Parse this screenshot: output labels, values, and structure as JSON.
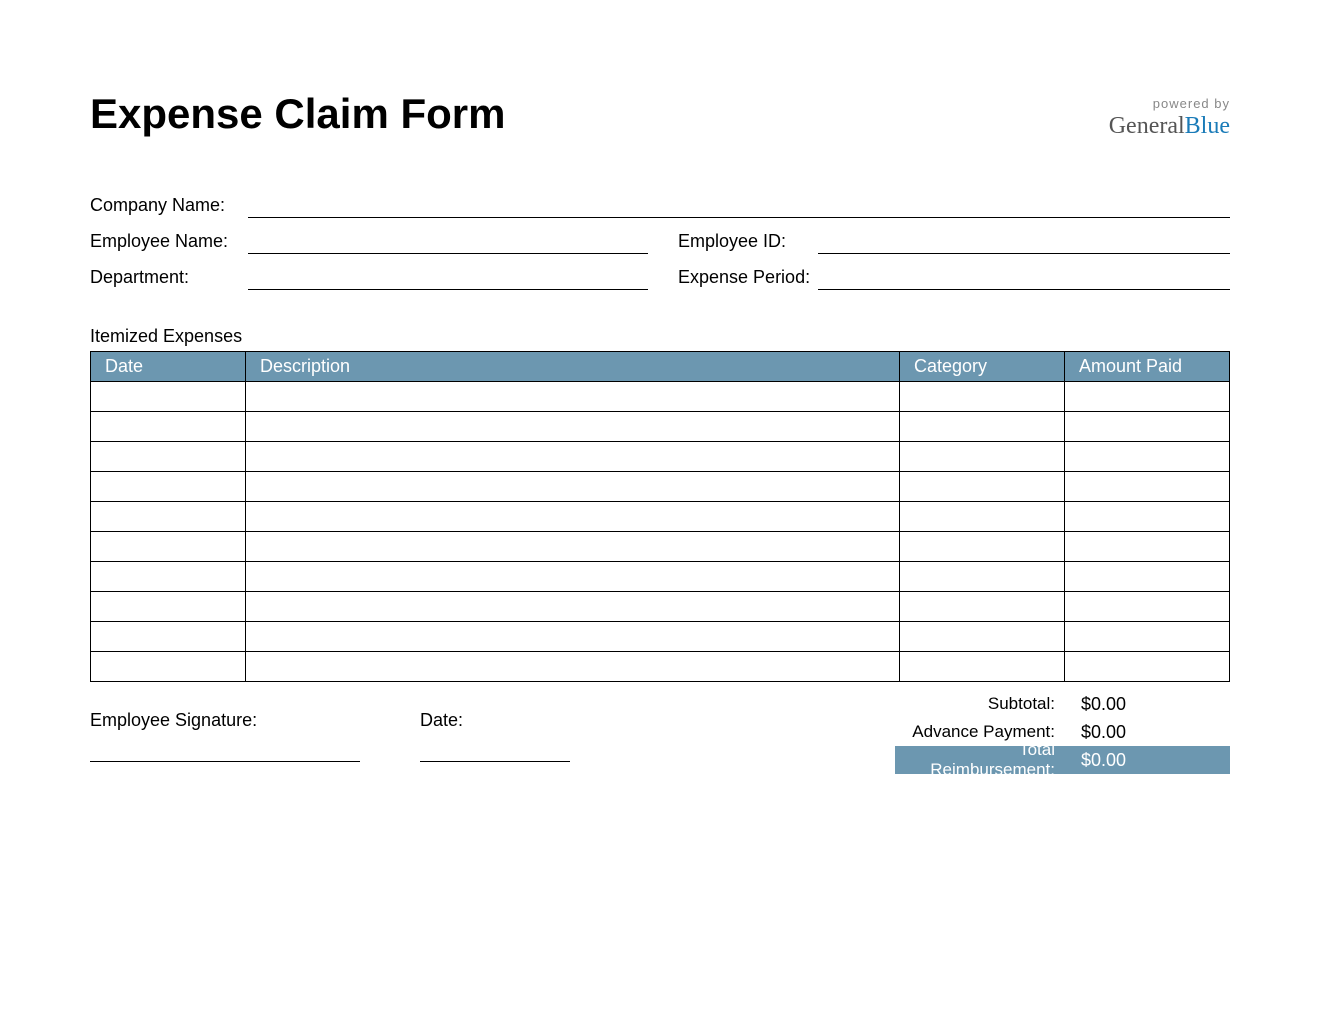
{
  "title": "Expense Claim Form",
  "logo": {
    "powered": "powered by",
    "brand1": "General",
    "brand2": "Blue"
  },
  "fields": {
    "company_name": {
      "label": "Company Name:",
      "value": ""
    },
    "employee_name": {
      "label": "Employee Name:",
      "value": ""
    },
    "employee_id": {
      "label": "Employee ID:",
      "value": ""
    },
    "department": {
      "label": "Department:",
      "value": ""
    },
    "expense_period": {
      "label": "Expense Period:",
      "value": ""
    }
  },
  "itemized": {
    "section_label": "Itemized Expenses",
    "columns": {
      "date": "Date",
      "description": "Description",
      "category": "Category",
      "amount": "Amount Paid"
    },
    "rows": [
      {
        "date": "",
        "description": "",
        "category": "",
        "amount": ""
      },
      {
        "date": "",
        "description": "",
        "category": "",
        "amount": ""
      },
      {
        "date": "",
        "description": "",
        "category": "",
        "amount": ""
      },
      {
        "date": "",
        "description": "",
        "category": "",
        "amount": ""
      },
      {
        "date": "",
        "description": "",
        "category": "",
        "amount": ""
      },
      {
        "date": "",
        "description": "",
        "category": "",
        "amount": ""
      },
      {
        "date": "",
        "description": "",
        "category": "",
        "amount": ""
      },
      {
        "date": "",
        "description": "",
        "category": "",
        "amount": ""
      },
      {
        "date": "",
        "description": "",
        "category": "",
        "amount": ""
      },
      {
        "date": "",
        "description": "",
        "category": "",
        "amount": ""
      }
    ]
  },
  "totals": {
    "subtotal": {
      "label": "Subtotal:",
      "value": "$0.00"
    },
    "advance": {
      "label": "Advance Payment:",
      "value": "$0.00"
    },
    "reimbursement": {
      "label": "Total Reimbursement:",
      "value": "$0.00"
    }
  },
  "signature": {
    "employee_sig": "Employee Signature:",
    "date": "Date:"
  }
}
